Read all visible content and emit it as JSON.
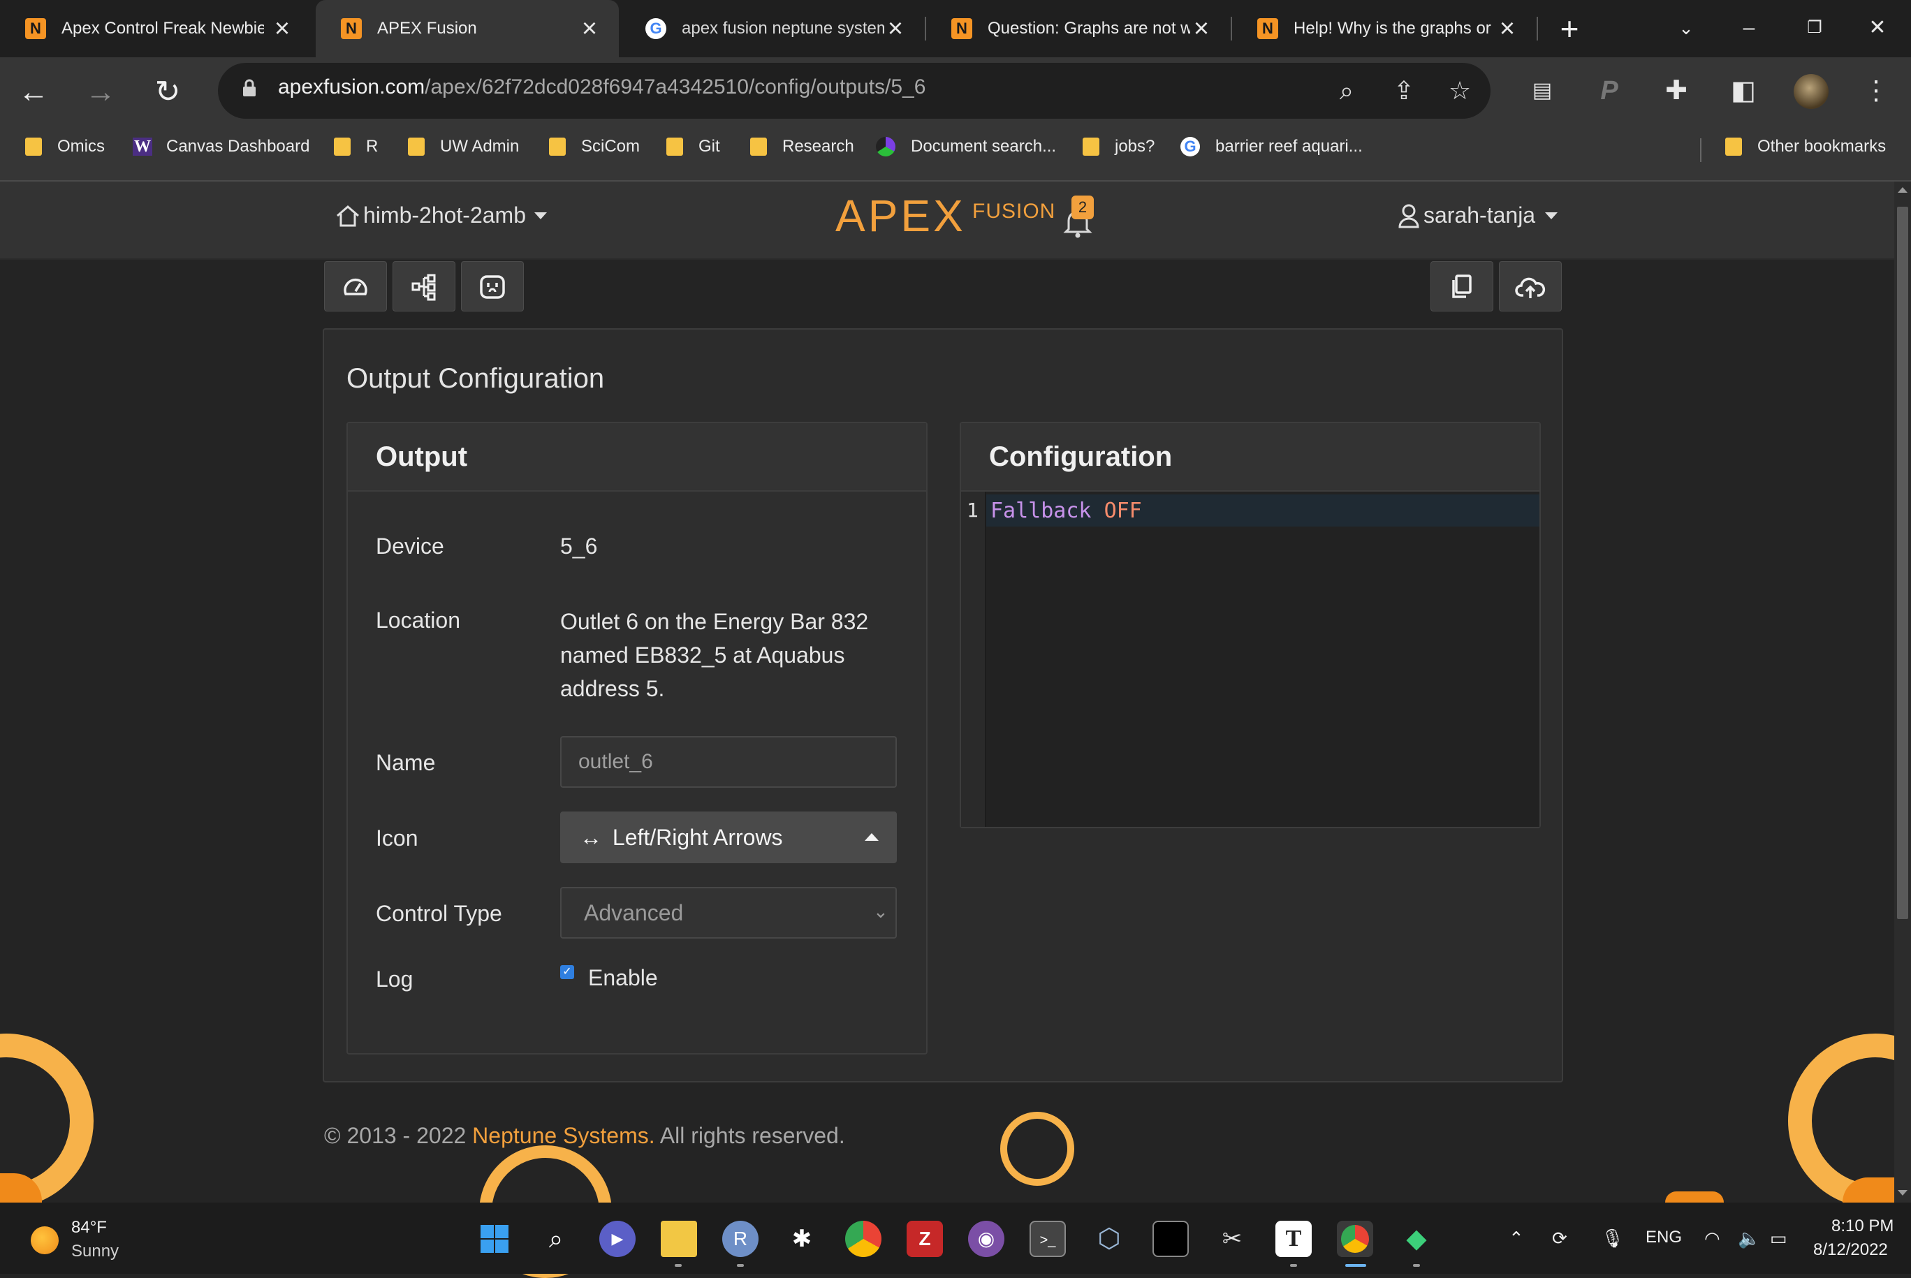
{
  "browser": {
    "tabs": [
      {
        "title": "Apex Control Freak Newbie",
        "icon": "neptune-logo-icon",
        "active": false
      },
      {
        "title": "APEX Fusion",
        "icon": "neptune-logo-icon",
        "active": true
      },
      {
        "title": "apex fusion neptune system",
        "icon": "google-icon",
        "active": false
      },
      {
        "title": "Question: Graphs are not w",
        "icon": "neptune-logo-icon",
        "active": false
      },
      {
        "title": "Help! Why is the graphs or",
        "icon": "neptune-logo-icon",
        "active": false
      }
    ],
    "url_host": "apexfusion.com",
    "url_path": "/apex/62f72dcd028f6947a4342510/config/outputs/5_6",
    "bookmarks": [
      {
        "label": "Omics",
        "icon": "folder-icon"
      },
      {
        "label": "Canvas Dashboard",
        "icon": "uw-logo-icon"
      },
      {
        "label": "R",
        "icon": "folder-icon"
      },
      {
        "label": "UW Admin",
        "icon": "folder-icon"
      },
      {
        "label": "SciCom",
        "icon": "folder-icon"
      },
      {
        "label": "Git",
        "icon": "folder-icon"
      },
      {
        "label": "Research",
        "icon": "folder-icon"
      },
      {
        "label": "Document search...",
        "icon": "document-search-icon"
      },
      {
        "label": "jobs?",
        "icon": "folder-icon"
      },
      {
        "label": "barrier reef aquari...",
        "icon": "google-icon"
      }
    ],
    "other_bookmarks": "Other bookmarks"
  },
  "header": {
    "apex_name": "himb-2hot-2amb",
    "logo_apex": "APEX",
    "logo_fusion": "FUSION",
    "notification_count": "2",
    "username": "sarah-tanja"
  },
  "main": {
    "card_title": "Output Configuration",
    "output_panel": {
      "title": "Output",
      "device_label": "Device",
      "device_value": "5_6",
      "location_label": "Location",
      "location_value": "Outlet 6 on the Energy Bar 832 named EB832_5 at Aquabus address 5.",
      "name_label": "Name",
      "name_value": "outlet_6",
      "icon_label": "Icon",
      "icon_glyph": "↔",
      "icon_value": "Left/Right Arrows",
      "control_type_label": "Control Type",
      "control_type_value": "Advanced",
      "log_label": "Log",
      "log_checked": true,
      "log_option": "Enable"
    },
    "config_panel": {
      "title": "Configuration",
      "line_number": "1",
      "code_keyword": "Fallback",
      "code_value": "OFF"
    }
  },
  "footer": {
    "prefix": "© 2013 - 2022 ",
    "brand": "Neptune Systems.",
    "suffix": " All rights reserved."
  },
  "taskbar": {
    "weather_temp": "84°F",
    "weather_condition": "Sunny",
    "language": "ENG",
    "time": "8:10 PM",
    "date": "8/12/2022"
  },
  "colors": {
    "accent": "#f2a03d",
    "page_bg": "#242424",
    "panel_bg": "#2e2e2e",
    "code_keyword": "#c792ea",
    "code_value": "#f78c6c",
    "checkbox": "#2f7fe0"
  }
}
